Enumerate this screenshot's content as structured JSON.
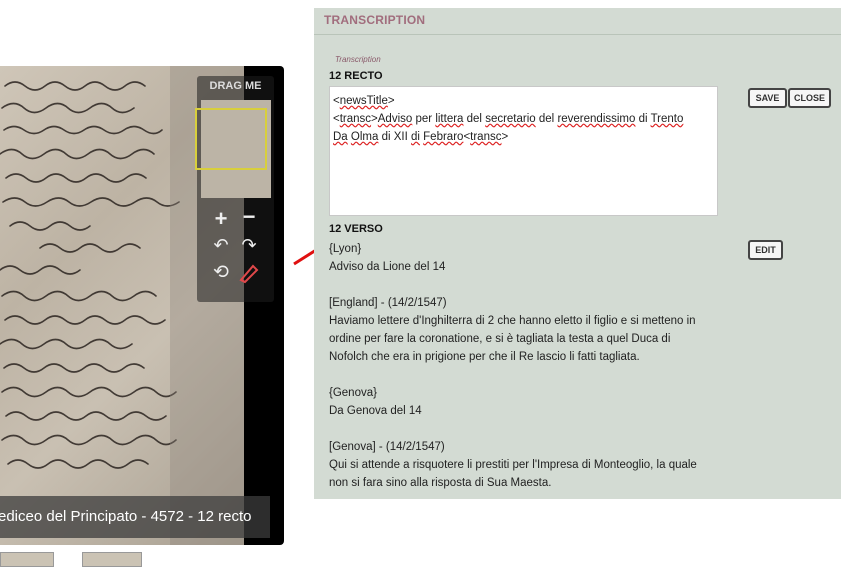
{
  "viewer": {
    "drag_label": "DRAG ME",
    "caption": "ediceo del Principato - 4572 - 12 recto",
    "zoom_in_icon": "plus-icon",
    "zoom_out_icon": "minus-icon",
    "rotate_left_icon": "rotate-left-icon",
    "rotate_right_icon": "rotate-right-icon",
    "reset_icon": "refresh-icon",
    "flip_icon": "flip-icon"
  },
  "panel": {
    "title": "TRANSCRIPTION",
    "field_label": "Transcription",
    "recto": {
      "title": "12 RECTO",
      "line1_a": "<",
      "line1_b": "newsTitle",
      "line1_c": ">",
      "line2_a": "<",
      "line2_b": "transc",
      "line2_c": ">",
      "line2_d": "Adviso",
      "line2_e": " per ",
      "line2_f": "littera",
      "line2_g": " del ",
      "line2_h": "secretario",
      "line2_i": " del ",
      "line2_j": "reverendissimo",
      "line2_k": " di ",
      "line2_l": "Trento",
      "line3_a": "Da",
      "line3_b": " ",
      "line3_c": "Olma",
      "line3_d": " di XII ",
      "line3_e": "di",
      "line3_f": " ",
      "line3_g": "Febraro",
      "line3_h": "<",
      "line3_i": "transc",
      "line3_j": ">",
      "save_label": "SAVE",
      "close_label": "CLOSE"
    },
    "verso": {
      "title": "12 VERSO",
      "edit_label": "EDIT",
      "paragraphs": [
        "{Lyon}",
        "Adviso da Lione del 14",
        "",
        "[England] - (14/2/1547)",
        "Haviamo lettere d'Inghilterra di 2 che hanno eletto il figlio e si metteno in",
        "ordine per fare la coronatione, e si è tagliata la testa a quel Duca di",
        "Nofolch che era in prigione per che il Re lascio li fatti tagliata.",
        "",
        "{Genova}",
        "Da Genova del 14",
        "",
        "[Genova] - (14/2/1547)",
        "Qui si attende a risquotere li prestiti per l'Impresa di Monteoglio, la quale",
        "non si fara sino alla risposta di Sua Maesta."
      ]
    }
  }
}
